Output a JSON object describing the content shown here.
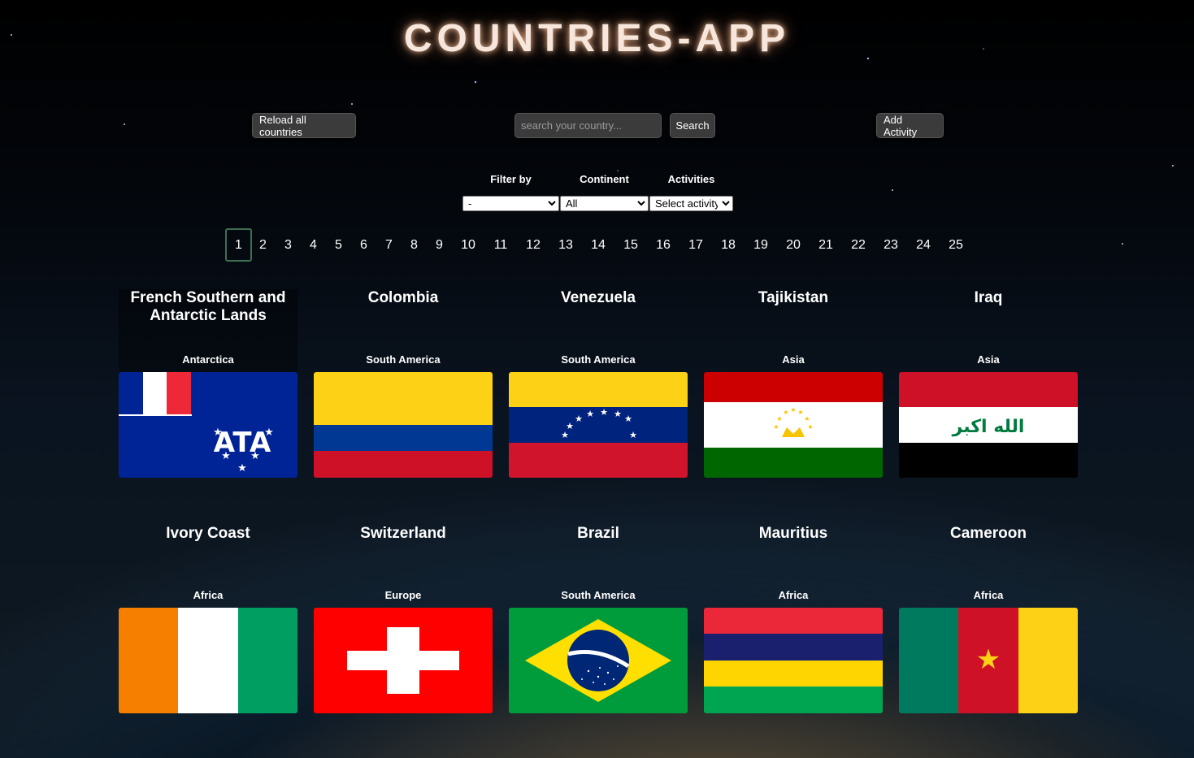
{
  "app": {
    "title": "COUNTRIES-APP"
  },
  "toolbar": {
    "reload_label": "Reload all countries",
    "search_placeholder": "search your country...",
    "search_label": "Search",
    "add_activity_label": "Add Activity"
  },
  "filters": {
    "filter_by_label": "Filter by",
    "continent_label": "Continent",
    "activities_label": "Activities",
    "filter_by_value": "-",
    "continent_value": "All",
    "activities_value": "Select activity"
  },
  "pagination": {
    "current": 1,
    "pages": [
      "1",
      "2",
      "3",
      "4",
      "5",
      "6",
      "7",
      "8",
      "9",
      "10",
      "11",
      "12",
      "13",
      "14",
      "15",
      "16",
      "17",
      "18",
      "19",
      "20",
      "21",
      "22",
      "23",
      "24",
      "25"
    ]
  },
  "countries": [
    {
      "name": "French Southern and Antarctic Lands",
      "continent": "Antarctica",
      "flag": "french-southern-antarctic-lands-flag"
    },
    {
      "name": "Colombia",
      "continent": "South America",
      "flag": "colombia-flag"
    },
    {
      "name": "Venezuela",
      "continent": "South America",
      "flag": "venezuela-flag"
    },
    {
      "name": "Tajikistan",
      "continent": "Asia",
      "flag": "tajikistan-flag"
    },
    {
      "name": "Iraq",
      "continent": "Asia",
      "flag": "iraq-flag",
      "flag_text": "الله اكبر"
    },
    {
      "name": "Ivory Coast",
      "continent": "Africa",
      "flag": "ivory-coast-flag"
    },
    {
      "name": "Switzerland",
      "continent": "Europe",
      "flag": "switzerland-flag"
    },
    {
      "name": "Brazil",
      "continent": "South America",
      "flag": "brazil-flag"
    },
    {
      "name": "Mauritius",
      "continent": "Africa",
      "flag": "mauritius-flag"
    },
    {
      "name": "Cameroon",
      "continent": "Africa",
      "flag": "cameroon-flag"
    }
  ],
  "colors": {
    "button_bg": "#3b3b3b",
    "active_page_border": "#3f6f52",
    "title_glow": "#ffc8a0"
  }
}
